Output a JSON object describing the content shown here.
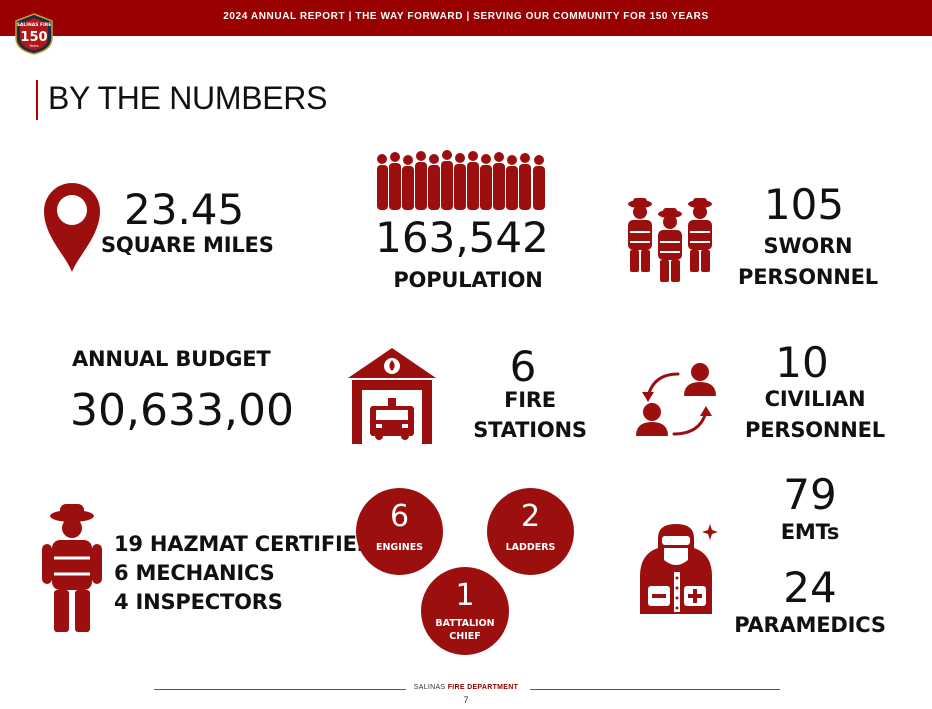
{
  "header": {
    "banner": "2024 ANNUAL REPORT | THE WAY FORWARD | SERVING OUR COMMUNITY FOR 150 YEARS",
    "badge_text": "SALINAS FIRE 150"
  },
  "title": "BY THE NUMBERS",
  "stats": {
    "area": {
      "value": "23.45",
      "label": "SQUARE MILES"
    },
    "population": {
      "value": "163,542",
      "label": "POPULATION"
    },
    "sworn": {
      "value": "105",
      "label_line1": "SWORN",
      "label_line2": "PERSONNEL"
    },
    "budget": {
      "label": "ANNUAL BUDGET",
      "value": "30,633,00"
    },
    "stations": {
      "value": "6",
      "label_line1": "FIRE",
      "label_line2": "STATIONS"
    },
    "civilian": {
      "value": "10",
      "label_line1": "CIVILIAN",
      "label_line2": "PERSONNEL"
    },
    "certs": [
      "19 HAZMAT CERTIFIED",
      "6 MECHANICS",
      "4 INSPECTORS"
    ],
    "apparatus": [
      {
        "value": "6",
        "label_line1": "ENGINES",
        "label_line2": ""
      },
      {
        "value": "2",
        "label_line1": "LADDERS",
        "label_line2": ""
      },
      {
        "value": "1",
        "label_line1": "BATTALION",
        "label_line2": "CHIEF"
      }
    ],
    "emts": {
      "value": "79",
      "label": "EMTs"
    },
    "paramedics": {
      "value": "24",
      "label": "PARAMEDICS"
    }
  },
  "footer": {
    "dept_prefix": "SALINAS ",
    "dept_bold": "FIRE DEPARTMENT",
    "page": "7"
  },
  "colors": {
    "accent": "#990000",
    "icon": "#9c0f0f"
  }
}
